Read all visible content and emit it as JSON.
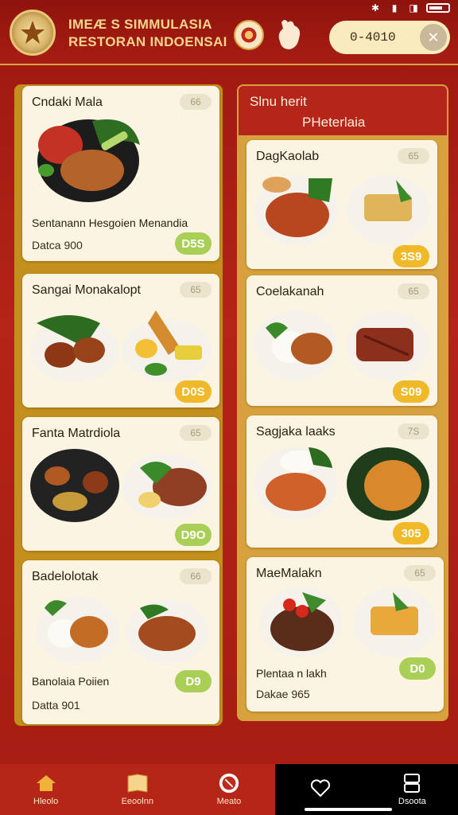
{
  "app": {
    "title_line1": "IMEÆ S SIMMULASIA",
    "title_line2": "RESTORAN INDOENSAI",
    "search_value": "0-4010",
    "close_label": "✕"
  },
  "colors": {
    "header_red": "#a81d13",
    "gold": "#d9a441",
    "card_bg": "#fbf4e2",
    "price_green": "#a9cf57",
    "price_yellow": "#f0b92a"
  },
  "icons": {
    "logo": "emblem-icon",
    "badge": "restaurant-badge-icon",
    "chicken": "chicken-icon",
    "close": "close-icon"
  },
  "right_panel": {
    "title": "Slnu herit",
    "subtitle": "PHeterlaia"
  },
  "left_cards": [
    {
      "title": "Cndaki Mala",
      "tag": "66",
      "price": "D5S",
      "price_color": "green",
      "line1": "Sentanann Hesgoien Menandia",
      "line2": "Datca 900"
    },
    {
      "title": "Sangai Monakalopt",
      "tag": "65",
      "price": "D0S",
      "price_color": "yellow",
      "line1": "",
      "line2": ""
    },
    {
      "title": "Fanta Matrdiola",
      "tag": "65",
      "price": "D9O",
      "price_color": "green",
      "line1": "",
      "line2": ""
    },
    {
      "title": "Badelolotak",
      "tag": "66",
      "price": "D9",
      "price_color": "green",
      "line1": "Banolaia Poiien",
      "line2": "Datta 901"
    }
  ],
  "right_cards": [
    {
      "title": "DagKaolab",
      "tag": "65",
      "price": "3S9",
      "price_color": "yellow",
      "line1": "",
      "line2": ""
    },
    {
      "title": "Coelakanah",
      "tag": "65",
      "price": "S09",
      "price_color": "yellow",
      "line1": "",
      "line2": ""
    },
    {
      "title": "Sagjaka laaks",
      "tag": "7S",
      "price": "305",
      "price_color": "yellow",
      "line1": "",
      "line2": ""
    },
    {
      "title": "MaeMalakn",
      "tag": "65",
      "price": "D0",
      "price_color": "green",
      "line1": "Plentaa n lakh",
      "line2": "Dakae 965"
    }
  ],
  "bottom_nav": [
    {
      "label": "Hleolo",
      "icon": "home-icon"
    },
    {
      "label": "Eeoolnn",
      "icon": "menu-book-icon"
    },
    {
      "label": "Meato",
      "icon": "plate-icon"
    },
    {
      "label": "",
      "icon": "heart-icon"
    },
    {
      "label": "Dsoota",
      "icon": "copy-icon"
    }
  ]
}
